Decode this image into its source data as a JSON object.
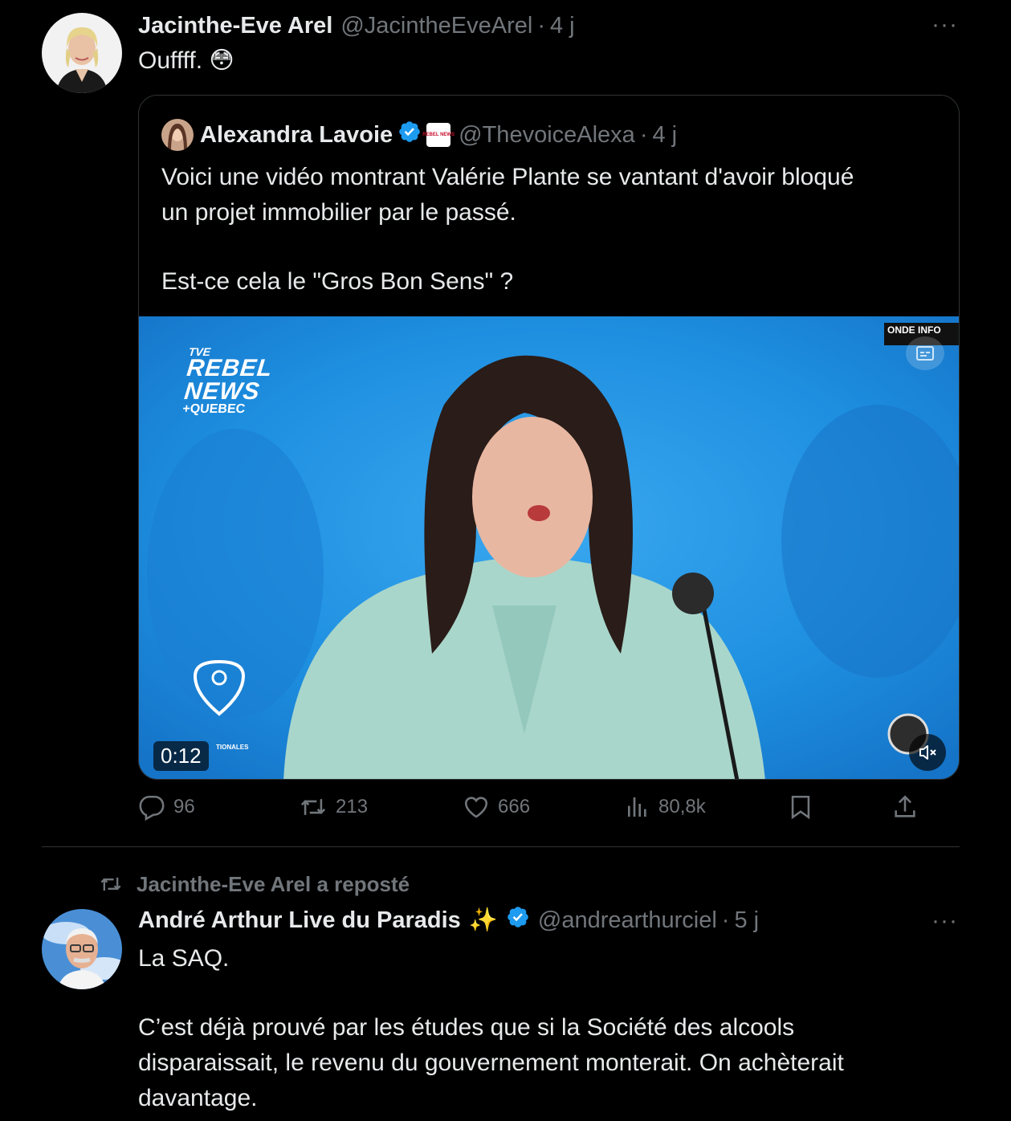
{
  "tweet1": {
    "author_name": "Jacinthe-Eve Arel",
    "handle": "@JacintheEveArel",
    "separator": "·",
    "time": "4 j",
    "more_label": "···",
    "text": "Ouffff.",
    "emoji": "😳",
    "quote": {
      "author_name": "Alexandra Lavoie",
      "handle": "@ThevoiceAlexa",
      "separator": "·",
      "time": "4 j",
      "affiliate_badge": "REBEL NEWS",
      "text_line1": "Voici une vidéo montrant Valérie Plante se vantant d'avoir bloqué",
      "text_line2": "un projet immobilier par le passé.",
      "text_line3": "Est-ce cela le \"Gros Bon Sens\" ?",
      "video": {
        "duration": "0:12",
        "watermark_line1": "TVE",
        "watermark_line2": "REBEL",
        "watermark_line3": "NEWS",
        "watermark_line4": "+QUEBEC",
        "corner_label": "ONDE INFO",
        "location_caption": "TIONALES"
      }
    },
    "actions": {
      "replies": "96",
      "reposts": "213",
      "likes": "666",
      "views": "80,8k"
    }
  },
  "tweet2": {
    "repost_label": "Jacinthe-Eve Arel a reposté",
    "author_name": "André Arthur Live du Paradis",
    "sparkles": "✨",
    "handle": "@andrearthurciel",
    "separator": "·",
    "time": "5 j",
    "more_label": "···",
    "text_line1": "La SAQ.",
    "text_line2": "C’est déjà prouvé par les études que si la Société des alcools",
    "text_line3": "disparaissait, le revenu du gouvernement monterait. On achèterait",
    "text_line4": "davantage."
  },
  "colors": {
    "background": "#000000",
    "text": "#e7e9ea",
    "muted": "#71767b",
    "verified": "#1d9bf0",
    "border": "#2f3336"
  }
}
